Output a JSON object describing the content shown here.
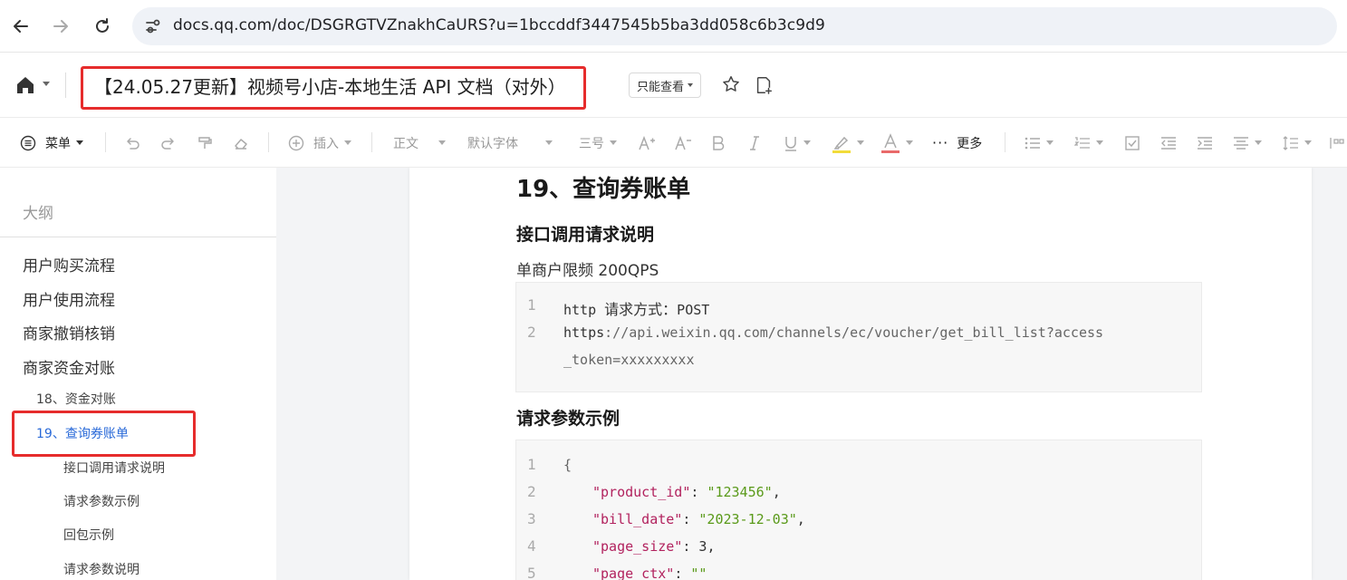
{
  "browser": {
    "url": "docs.qq.com/doc/DSGRGTVZnakhCaURS?u=1bccddf3447545b5ba3dd058c6b3c9d9"
  },
  "header": {
    "title": "【24.05.27更新】视频号小店-本地生活 API 文档（对外）",
    "readonly_label": "只能查看"
  },
  "toolbar": {
    "menu_label": "菜单",
    "insert_label": "插入",
    "style_label": "正文",
    "font_label": "默认字体",
    "size_label": "三号",
    "more_label": "更多"
  },
  "sidebar": {
    "outline_title": "大纲",
    "items": [
      {
        "label": "用户购买流程",
        "level": 1
      },
      {
        "label": "用户使用流程",
        "level": 1
      },
      {
        "label": "商家撤销核销",
        "level": 1
      },
      {
        "label": "商家资金对账",
        "level": 1
      },
      {
        "label": "18、资金对账",
        "level": 2
      },
      {
        "label": "19、查询券账单",
        "level": 2,
        "active": true
      },
      {
        "label": "接口调用请求说明",
        "level": 3
      },
      {
        "label": "请求参数示例",
        "level": 3
      },
      {
        "label": "回包示例",
        "level": 3
      },
      {
        "label": "请求参数说明",
        "level": 3
      }
    ]
  },
  "doc": {
    "heading": "19、查询券账单",
    "section1_title": "接口调用请求说明",
    "rate_limit": "单商户限频 200QPS",
    "code1": {
      "line_numbers": [
        "1",
        "2"
      ],
      "line1_prefix": "http ",
      "line1_cn": "请求方式：",
      "line1_method": "POST",
      "line2_a": "https",
      "line2_b": "://api.weixin.qq.com/channels/ec/voucher/get_bill_list?access",
      "line2_c": "_token=xxxxxxxxx"
    },
    "section2_title": "请求参数示例",
    "code2": {
      "line_numbers": [
        "1",
        "2",
        "3",
        "4",
        "5"
      ],
      "brace": "{",
      "keys": [
        "\"product_id\"",
        "\"bill_date\"",
        "\"page_size\"",
        "\"page_ctx\""
      ],
      "values": [
        "\"123456\"",
        "\"2023-12-03\"",
        "3",
        "\"\""
      ],
      "seps": [
        ": ",
        ": ",
        ": ",
        ": "
      ],
      "ends": [
        ",",
        ",",
        ",",
        ""
      ]
    }
  },
  "colors": {
    "accent_blue": "#2a6ad8",
    "highlight_red": "#e62c2c",
    "code_key": "#b2225e",
    "code_string": "#5a9a1a"
  }
}
